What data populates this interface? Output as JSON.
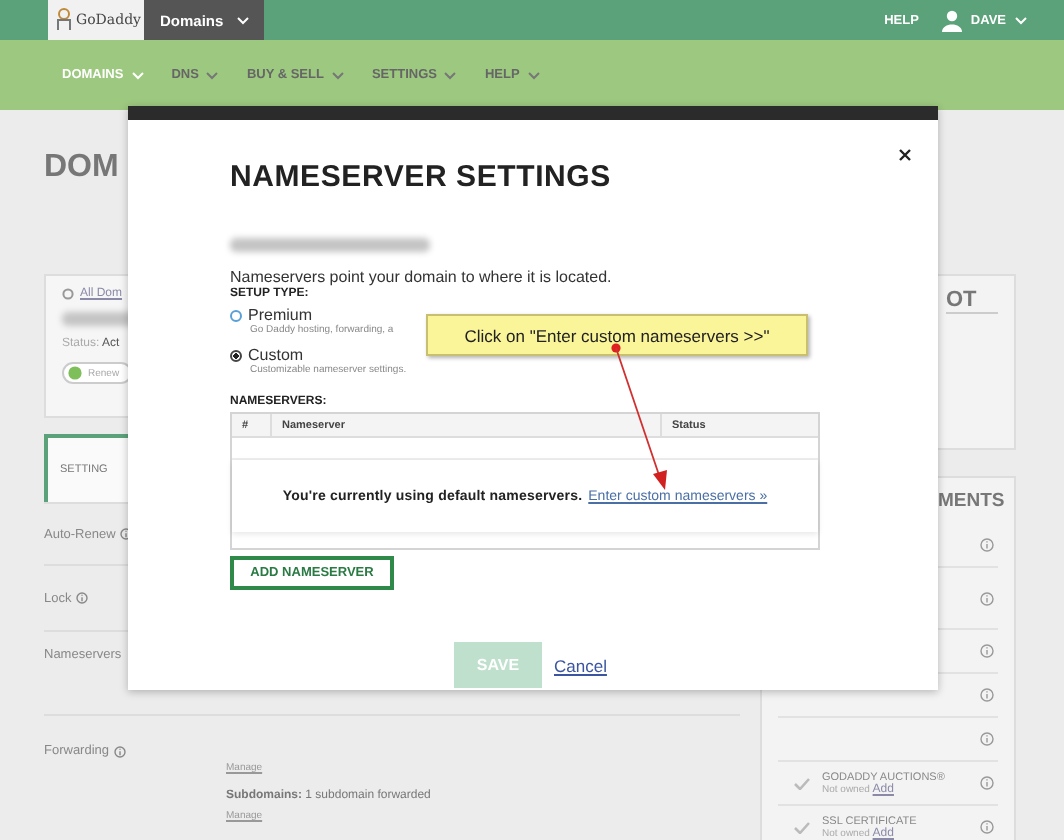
{
  "topbar": {
    "logo": "GoDaddy",
    "product_menu": "Domains",
    "help": "HELP",
    "user": "DAVE"
  },
  "nav": [
    {
      "label": "DOMAINS",
      "selected": true
    },
    {
      "label": "DNS",
      "selected": false
    },
    {
      "label": "BUY & SELL",
      "selected": false
    },
    {
      "label": "SETTINGS",
      "selected": false
    },
    {
      "label": "HELP",
      "selected": false
    }
  ],
  "page": {
    "heading": "DOM",
    "domain_card": {
      "link": "All Dom",
      "status_label": "Status:",
      "status_value": "Act",
      "renew": "Renew"
    },
    "tab": "SETTING",
    "settings": [
      {
        "label": "Auto-Renew",
        "info": true
      },
      {
        "label": "Lock",
        "info": true
      },
      {
        "label": "Nameservers",
        "info": false
      },
      {
        "label": "Forwarding",
        "info": true
      }
    ],
    "forwarding_details": [
      {
        "kind": "link",
        "text": "Manage"
      },
      {
        "kind": "text",
        "text": "**Subdomains:** 1 subdomain forwarded"
      },
      {
        "kind": "link",
        "text": "Manage"
      }
    ],
    "snapshot_title": "OT",
    "enhancements_title": "MENTS",
    "enhancements": [
      {
        "kind": "covered"
      },
      {
        "kind": "covered"
      },
      {
        "kind": "covered"
      },
      {
        "kind": "covered"
      },
      {
        "kind": "covered"
      },
      {
        "kind": "product",
        "name": "GODADDY AUCTIONS®",
        "status": "Not owned",
        "action": "Add"
      },
      {
        "kind": "product",
        "name": "SSL CERTIFICATE",
        "status": "Not owned",
        "action": "Add"
      }
    ]
  },
  "modal": {
    "title": "NAMESERVER SETTINGS",
    "description": "Nameservers point your domain to where it is located.",
    "setup_label": "SETUP TYPE:",
    "options": [
      {
        "label": "Premium",
        "hint": "Go Daddy hosting, forwarding, a",
        "selected": false
      },
      {
        "label": "Custom",
        "hint": "Customizable nameserver settings.",
        "selected": true
      }
    ],
    "nameservers_label": "NAMESERVERS:",
    "columns": [
      "#",
      "Nameserver",
      "Status"
    ],
    "empty_message": "You're currently using default nameservers.",
    "empty_link": "Enter custom nameservers »",
    "add_button": "ADD NAMESERVER",
    "save_button": {
      "label": "SAVE",
      "disabled": true
    },
    "cancel": "Cancel"
  },
  "callout": {
    "text": "Click on \"Enter custom nameservers >>\""
  }
}
